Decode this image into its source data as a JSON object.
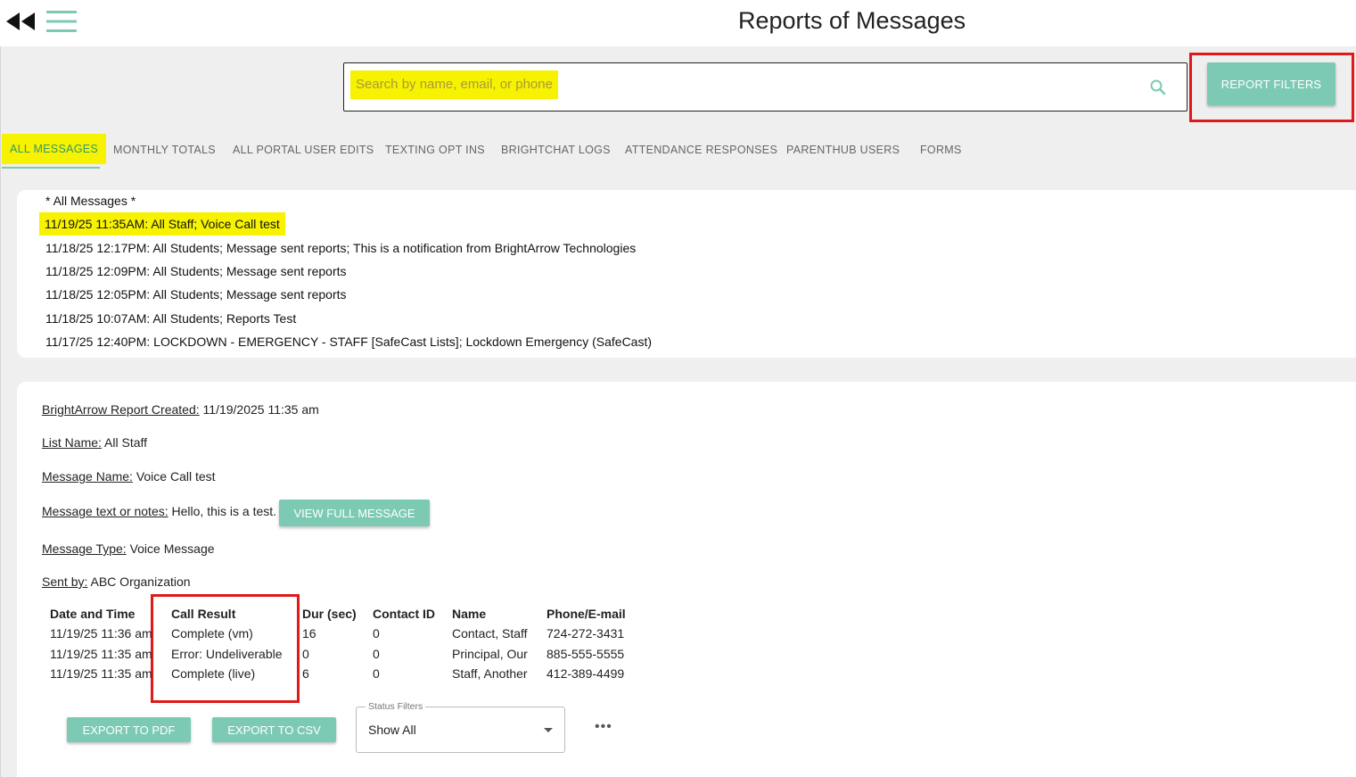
{
  "header": {
    "title": "Reports of Messages",
    "back_icon": "double-chevron-left-icon",
    "menu_icon": "hamburger-menu-icon"
  },
  "search": {
    "placeholder": "Search by name, email, or phone",
    "icon": "search-icon"
  },
  "report_filters_label": "REPORT FILTERS",
  "tabs": [
    {
      "label": "ALL MESSAGES",
      "active": true
    },
    {
      "label": "MONTHLY TOTALS"
    },
    {
      "label": "ALL PORTAL USER EDITS"
    },
    {
      "label": "TEXTING OPT INS"
    },
    {
      "label": "BRIGHTCHAT LOGS"
    },
    {
      "label": "ATTENDANCE RESPONSES"
    },
    {
      "label": "PARENTHUB USERS"
    },
    {
      "label": "FORMS"
    }
  ],
  "messages": [
    "* All Messages *",
    "11/19/25 11:35AM: All Staff; Voice Call test",
    "11/18/25 12:17PM: All Students; Message sent reports; This is a notification from BrightArrow Technologies",
    "11/18/25 12:09PM: All Students; Message sent reports",
    "11/18/25 12:05PM: All Students; Message sent reports",
    "11/18/25 10:07AM: All Students; Reports Test",
    "11/17/25 12:40PM: LOCKDOWN - EMERGENCY - STAFF [SafeCast Lists]; Lockdown Emergency (SafeCast)"
  ],
  "report": {
    "created_label": "BrightArrow Report Created:",
    "created_value": "11/19/2025 11:35 am",
    "list_label": "List Name:",
    "list_value": "All Staff",
    "message_name_label": "Message Name:",
    "message_name_value": "Voice Call test",
    "notes_label": "Message text or notes:",
    "notes_value": "Hello, this is a test.",
    "view_full_label": "VIEW FULL MESSAGE",
    "type_label": "Message Type:",
    "type_value": "Voice Message",
    "sent_by_label": "Sent by:",
    "sent_by_value": "ABC Organization"
  },
  "table": {
    "headers": [
      "Date and Time",
      "Call Result",
      "Dur (sec)",
      "Contact ID",
      "Name",
      "Phone/E-mail"
    ],
    "rows": [
      [
        "11/19/25 11:36 am",
        "Complete (vm)",
        "16",
        "0",
        "Contact, Staff",
        "724-272-3431"
      ],
      [
        "11/19/25 11:35 am",
        "Error: Undeliverable",
        "0",
        "0",
        "Principal, Our",
        "885-555-5555"
      ],
      [
        "11/19/25 11:35 am",
        "Complete (live)",
        "6",
        "0",
        "Staff, Another",
        "412-389-4499"
      ]
    ]
  },
  "export_pdf_label": "EXPORT TO PDF",
  "export_csv_label": "EXPORT TO CSV",
  "status_filter": {
    "legend": "Status Filters",
    "value": "Show All"
  },
  "more_label": "•••",
  "colors": {
    "accent": "#7ccab4",
    "highlight": "#f7f200",
    "annotation_red": "#e01a1a"
  }
}
